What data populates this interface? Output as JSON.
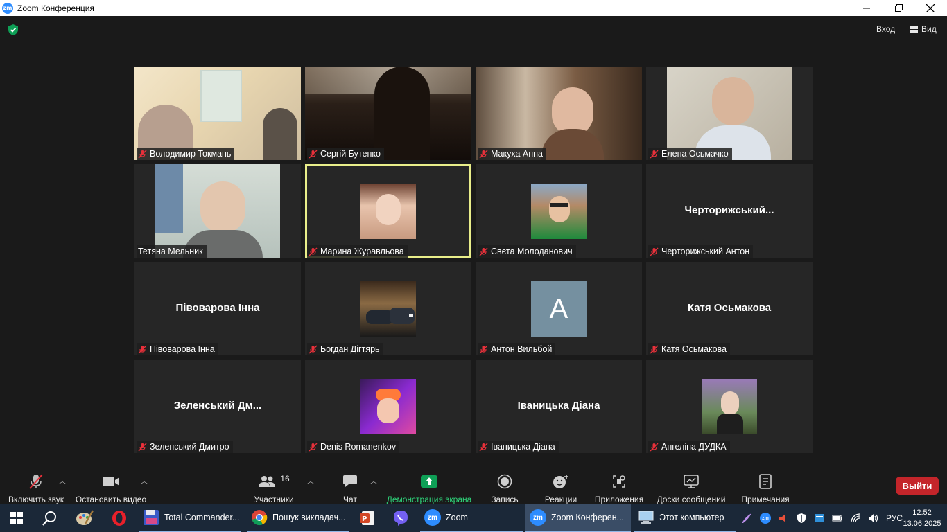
{
  "window": {
    "title": "Zoom Конференция",
    "app_icon_text": "zm"
  },
  "topbar": {
    "signin_label": "Вход",
    "view_label": "Вид"
  },
  "participants": [
    {
      "name": "Володимир Токмань",
      "type": "video",
      "muted": true
    },
    {
      "name": "Сергій Бутенко",
      "type": "video",
      "muted": true
    },
    {
      "name": "Макуха Анна",
      "type": "video",
      "muted": true
    },
    {
      "name": "Елена Осьмачко",
      "type": "video",
      "muted": true
    },
    {
      "name": "Тетяна Мельник",
      "type": "video",
      "muted": false
    },
    {
      "name": "Марина Журавльова",
      "type": "photo",
      "muted": true,
      "active_speaker": true
    },
    {
      "name": "Свєта Молоданович",
      "type": "photo",
      "muted": true
    },
    {
      "name": "Черторижський Антон",
      "display_name": "Черторижський...",
      "type": "name",
      "muted": true
    },
    {
      "name": "Півоварова Інна",
      "display_name": "Півоварова Інна",
      "type": "name",
      "muted": true
    },
    {
      "name": "Богдан Дігтярь",
      "type": "photo",
      "muted": true
    },
    {
      "name": "Антон Вильбой",
      "initial": "A",
      "type": "initial",
      "muted": true
    },
    {
      "name": "Катя Осьмакова",
      "display_name": "Катя Осьмакова",
      "type": "name",
      "muted": true
    },
    {
      "name": "Зеленський Дмитро",
      "display_name": "Зеленський  Дм...",
      "type": "name",
      "muted": true
    },
    {
      "name": "Denis Romanenkov",
      "type": "photo",
      "muted": true
    },
    {
      "name": "Іваницька Діана",
      "display_name": "Іваницька Діана",
      "type": "name",
      "muted": true
    },
    {
      "name": "Ангеліна ДУДКА",
      "type": "photo",
      "muted": true
    }
  ],
  "toolbar": {
    "unmute_label": "Включить звук",
    "stop_video_label": "Остановить видео",
    "participants_label": "Участники",
    "participants_count": "16",
    "chat_label": "Чат",
    "share_label": "Демонстрация экрана",
    "record_label": "Запись",
    "reactions_label": "Реакции",
    "apps_label": "Приложения",
    "whiteboards_label": "Доски сообщений",
    "notes_label": "Примечания",
    "leave_label": "Выйти"
  },
  "taskbar": {
    "apps": [
      {
        "label": "Total Commander..."
      },
      {
        "label": "Пошук викладач..."
      },
      {
        "label": "Zoom"
      },
      {
        "label": "Zoom Конферен..."
      },
      {
        "label": "Этот компьютер"
      }
    ],
    "lang": "РУС",
    "time": "12:52",
    "date": "13.06.2025"
  },
  "colors": {
    "accent_green": "#0e9f56",
    "share_green": "#0e9f56",
    "leave_red": "#c4252a",
    "active_outline": "#e9ee8a",
    "zoom_blue": "#2d8cff"
  }
}
